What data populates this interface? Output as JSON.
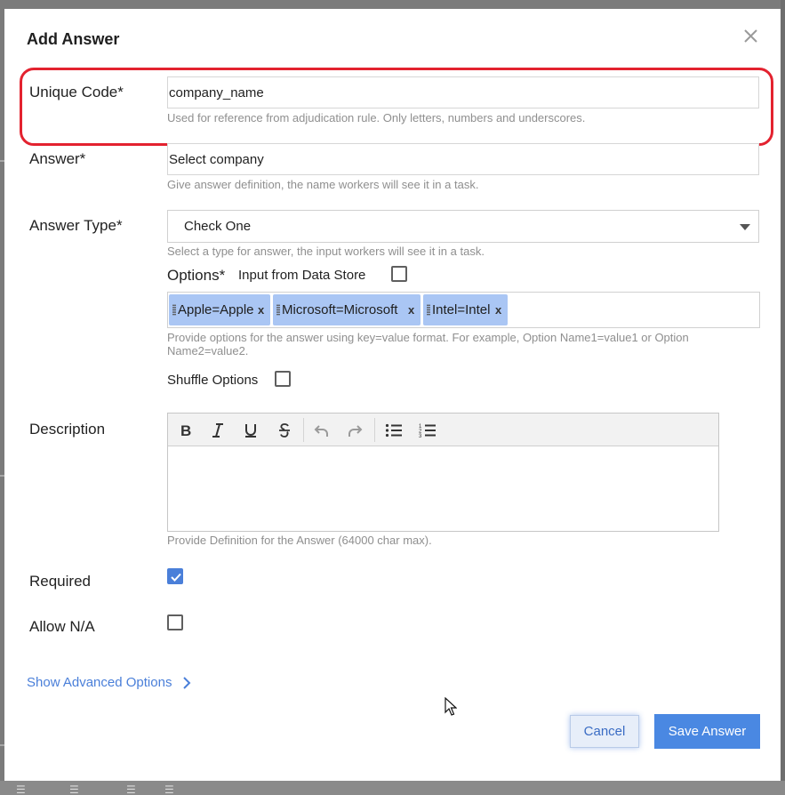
{
  "dialog": {
    "title": "Add Answer"
  },
  "unique_code": {
    "label": "Unique Code*",
    "value": "company_name",
    "hint": "Used for reference from adjudication rule. Only letters, numbers and underscores."
  },
  "answer": {
    "label": "Answer*",
    "value": "Select company",
    "hint": "Give answer definition, the name workers will see it in a task."
  },
  "answer_type": {
    "label": "Answer Type*",
    "selected": "Check One",
    "hint": "Select a type for answer, the input workers will see it in a task."
  },
  "options": {
    "label": "Options*",
    "data_store_label": "Input from Data Store",
    "data_store_checked": false,
    "tags": [
      "Apple=Apple",
      "Microsoft=Microsoft",
      "Intel=Intel"
    ],
    "remove_glyph": "x",
    "hint_line1": "Provide options for the answer using key=value format. For example, Option Name1=value1 or Option",
    "hint_line2": "Name2=value2.",
    "shuffle_label": "Shuffle Options",
    "shuffle_checked": false
  },
  "description": {
    "label": "Description",
    "toolbar": [
      "bold-icon",
      "italic-icon",
      "underline-icon",
      "strikethrough-icon",
      "undo-icon",
      "redo-icon",
      "bulleted-list-icon",
      "numbered-list-icon"
    ],
    "hint": "Provide Definition for the Answer (64000 char max)."
  },
  "required": {
    "label": "Required",
    "checked": true
  },
  "allow_na": {
    "label": "Allow N/A",
    "checked": false
  },
  "advanced": {
    "label": "Show Advanced Options"
  },
  "buttons": {
    "cancel": "Cancel",
    "save": "Save Answer"
  },
  "colors": {
    "accent": "#4a88e2",
    "highlight_border": "#e3222f",
    "tag_bg": "#aac6f4"
  }
}
